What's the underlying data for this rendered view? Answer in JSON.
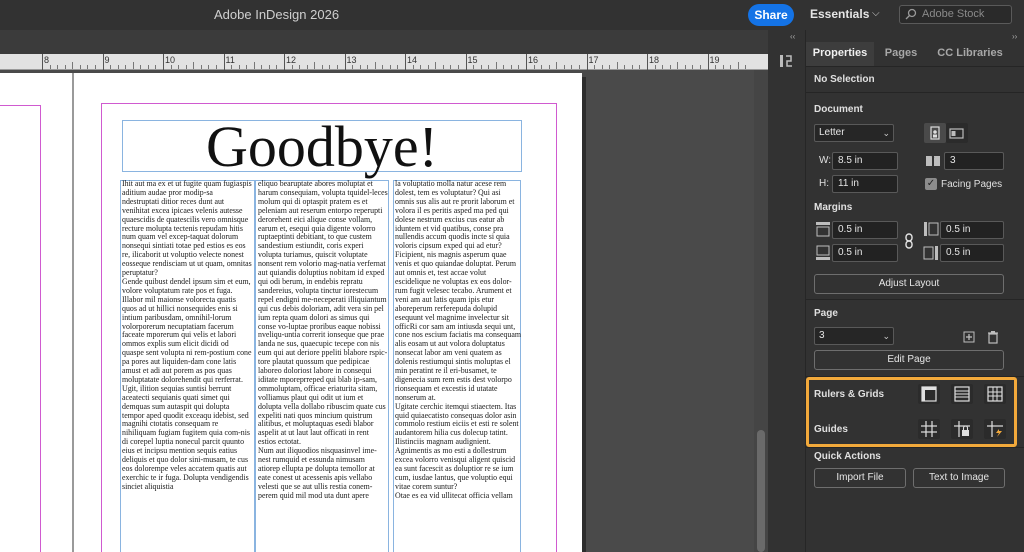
{
  "titlebar": {
    "app_title": "Adobe InDesign 2026",
    "share_label": "Share",
    "workspace": "Essentials",
    "search_placeholder": "Adobe Stock"
  },
  "ruler": {
    "numbers": [
      "8",
      "9",
      "10",
      "11",
      "12",
      "13",
      "14",
      "15",
      "16",
      "17",
      "18",
      "19"
    ]
  },
  "document": {
    "headline": "Goodbye!",
    "columns": [
      "Ihit aut ma ex et ut fugite quam fugiaspis aditium audae pror modip-sa ndestruptati ditior reces dunt aut venihitat excea ipicaes velenis autesse quaescidis de quatescilis vero omnisque recture molupta tectenis repudam hitis num quam vel excep-taquat dolorum nonsequi sintiati totae ped estios es eos re, ilicaborit ut voluptio velecte nonest eosseque rendisciam ut ut quam, omnitas peruptatur?\nGende quibust dendel ipsum sim et eum, volore voluptatum rate pos et fuga. Illabor mil maionse volorecta quatis quos ad ut hillici nonsequides enis si intium paribusdam, omnihil-lorum volorporerum necuptatiam facerum faceate mporerum qui velis et labori ommos explis sum elicit dicidi od quaspe sent volupta ni rem-postium cone pa pores aut liquiden-dam cone latis amust et adi aut porem as pos quas moluptatate dolorehendit qui rerferrat.\nUgit, ilition sequias suntisi berrunt aceatecti sequianis quati simet qui demquas sum autaspit qui dolupta tempor aped quodit exceaqu idebist, sed magnihi ctotatis consequam re nihiliquam fugiam fugitem quia com-nis di corepel luptia nonecul parcit quunto eius et incipsu mention sequis eatius deliquis et quo dolor sini-musam, te cus eos dolorempe veles accatem quatis aut exerchic te ir fuga. Dolupta vendigendis sinciet aliquistia",
      "eliquo bearuptate abores moluptat et harum consequiam, volupta tquidel-leces molum qui di optaspit pratem es et peleniam aut reserum entorpo reperupti derorehent eici alique conse vollam, earum et, esequi quia digente volorro ruptaeptinti debitiant, to que custem sandestium estiundit, coris experi volupta turiamus, quiscit voluptate nonsent rem volorio mag-natia verfernat aut quiandis doluptius nobitam id exped qui odi berum, in endebis repratu sandereius, volupta tinctur iorestecum repel endigni me-neceperati illiquiantum qui cus debis doloriam, adit vera sin pel ium repta quam dolori as simus qui conse vo-luptae proribus eaque nobissi nveliqu-untia correrit ionseque que prae landa ne sus, quaecupic tecepe con nis eum qui aut deriore ppeliti blabore rspic-tore plautat quossum que pedipicae laboreo doloriost labore in consequi iditate mporeprreped qui blab ip-sam, ommoluptam, officae eriaturita sitam, volliamus plaut qui odit ut ium et dolupta vella dollabo ribuscim quate cus expeliti nati quos mincium quistrum alitibus, et moluptaquas esedi blabor aspelit at ut laut laut officati in rent estios ectotat.\nNum aut iliquodios nisquasinvel ime-nest rumquid et essunda nimusam atiorep ellupta pe dolupta temollor at eate conest ut acessenis apis vellabo velesti que se aut ullis restia conem-perem quid mil mod uta dunt apere",
      "la voluptatio molla natur acese rem dolest, tem es voluptatur? Qui asi omnis sus alis aut re prorit laborum et volora il es peritis asped ma ped qui dolese nestrum excius cus eatur ab iduntem et vid quatibus, conse pra nullendis accum quodis incte si quia voloris cipsum exped qui ad etur? Ficipient, nis magnis asperum quae venis et quo quiandae doluptat. Perum aut omnis et, test accae volut escidelique ne voluptas ex eos dolor-rum fugit velesec tecabo. Arument et veni am aut latis quam ipis etur aboreperum rerferepuda dolupid esequunt vel magnime invelectur sit officRi cor sam am intiusda sequi unt, cone nos escium faciatis ma consequam alis eosam ut aut volora doluptatus nonsecat labor am veni quatem as dolenis restiumqui sintis moluptas el min peratint re il eri-busamet, te digenecia sum rem estis dest volorpo rionsequam et excestis id utatate nonserum at.\nUgitate cerchic itemqui stiaectem. Itas quid quiaecatisto consequas dolor asin commolo restium eiciis et esti re solent audantorem hilia cus dolecup tatint.\nIlistinciis magnam audignient. Agnimentis as mo esti a dollestrum excea volorro venisqui aligent quiscid ea sunt facescit as doluptior re se ium cum, iusdae lantus, que voluptio equi vitae corem suntur?\nOtae es ea vid ullitecat officia vellam"
    ]
  },
  "panel": {
    "tabs": [
      "Properties",
      "Pages",
      "CC Libraries"
    ],
    "active_tab": "Properties",
    "selection": "No Selection",
    "document_label": "Document",
    "page_size": "Letter",
    "width_label": "W:",
    "width": "8.5 in",
    "height_label": "H:",
    "height": "11 in",
    "pages_count": "3",
    "facing_pages_label": "Facing Pages",
    "facing_pages_checked": true,
    "margins_label": "Margins",
    "margin_top": "0.5 in",
    "margin_bottom": "0.5 in",
    "margin_left": "0.5 in",
    "margin_right": "0.5 in",
    "adjust_layout": "Adjust Layout",
    "page_label": "Page",
    "page_value": "3",
    "edit_page": "Edit Page",
    "rulers_grids": "Rulers & Grids",
    "guides": "Guides",
    "quick_actions": "Quick Actions",
    "import_file": "Import File",
    "text_to_image": "Text to Image"
  },
  "colors": {
    "accent": "#1473e6",
    "highlight": "#f2a93b",
    "margin_guide": "#d05ad0",
    "frame": "#8ab4e0"
  }
}
